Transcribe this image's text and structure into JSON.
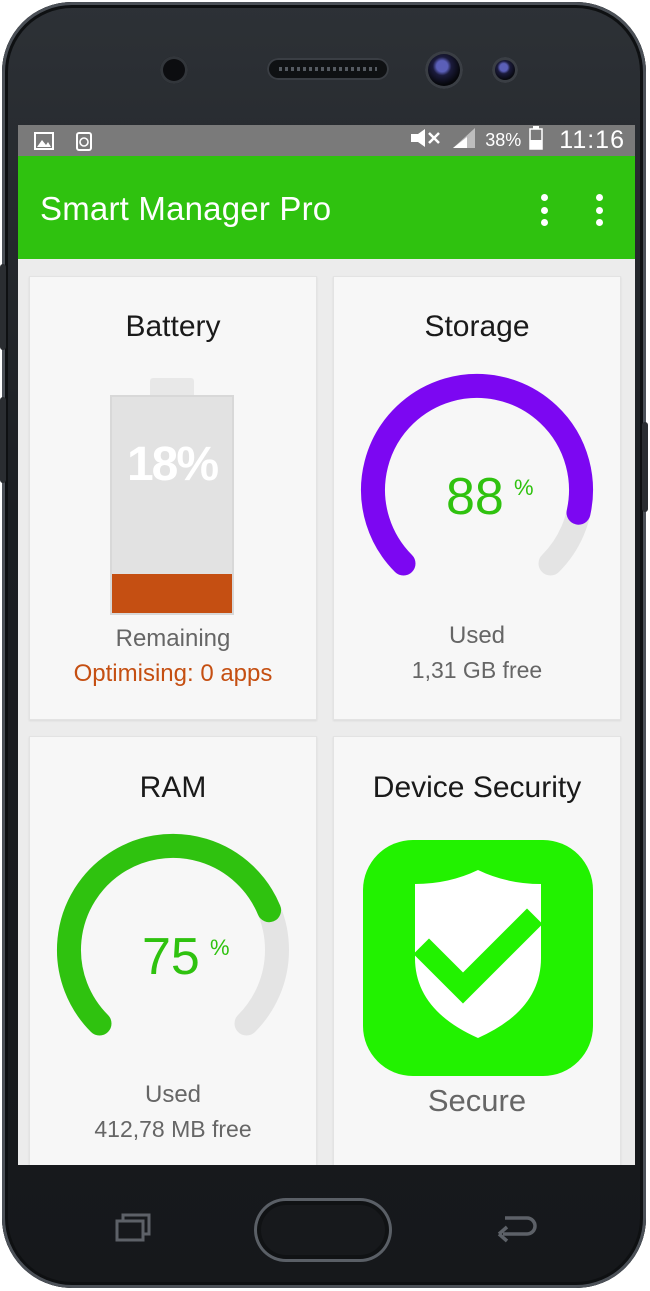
{
  "status_bar": {
    "battery_percent": "38%",
    "time": "11:16",
    "left_icons": [
      "gallery-notification-icon",
      "recycle-notification-icon"
    ],
    "right_icons": [
      "mute-icon",
      "signal-icon",
      "battery-icon"
    ]
  },
  "app_bar": {
    "title": "Smart Manager Pro",
    "actions": [
      "overflow-menu-icon",
      "overflow-menu-icon"
    ],
    "color": "#2fc20f"
  },
  "cards": {
    "battery": {
      "title": "Battery",
      "level": "18%",
      "level_fraction": 0.18,
      "status": "Remaining",
      "optimising": "Optimising: 0 apps",
      "fill_color": "#c54f12"
    },
    "storage": {
      "title": "Storage",
      "value": "88",
      "unit": "%",
      "used_fraction": 0.88,
      "label": "Used",
      "free": "1,31 GB free",
      "arc_color": "#7c07f2"
    },
    "ram": {
      "title": "RAM",
      "value": "75",
      "unit": "%",
      "used_fraction": 0.75,
      "label": "Used",
      "free": "412,78 MB free",
      "arc_color": "#2fc20f"
    },
    "security": {
      "title": "Device Security",
      "status": "Secure",
      "icon": "shield-check-icon",
      "color": "#22f200"
    }
  },
  "nav_bar": {
    "keys": [
      "recent-apps-icon",
      "home-key",
      "back-icon"
    ]
  }
}
